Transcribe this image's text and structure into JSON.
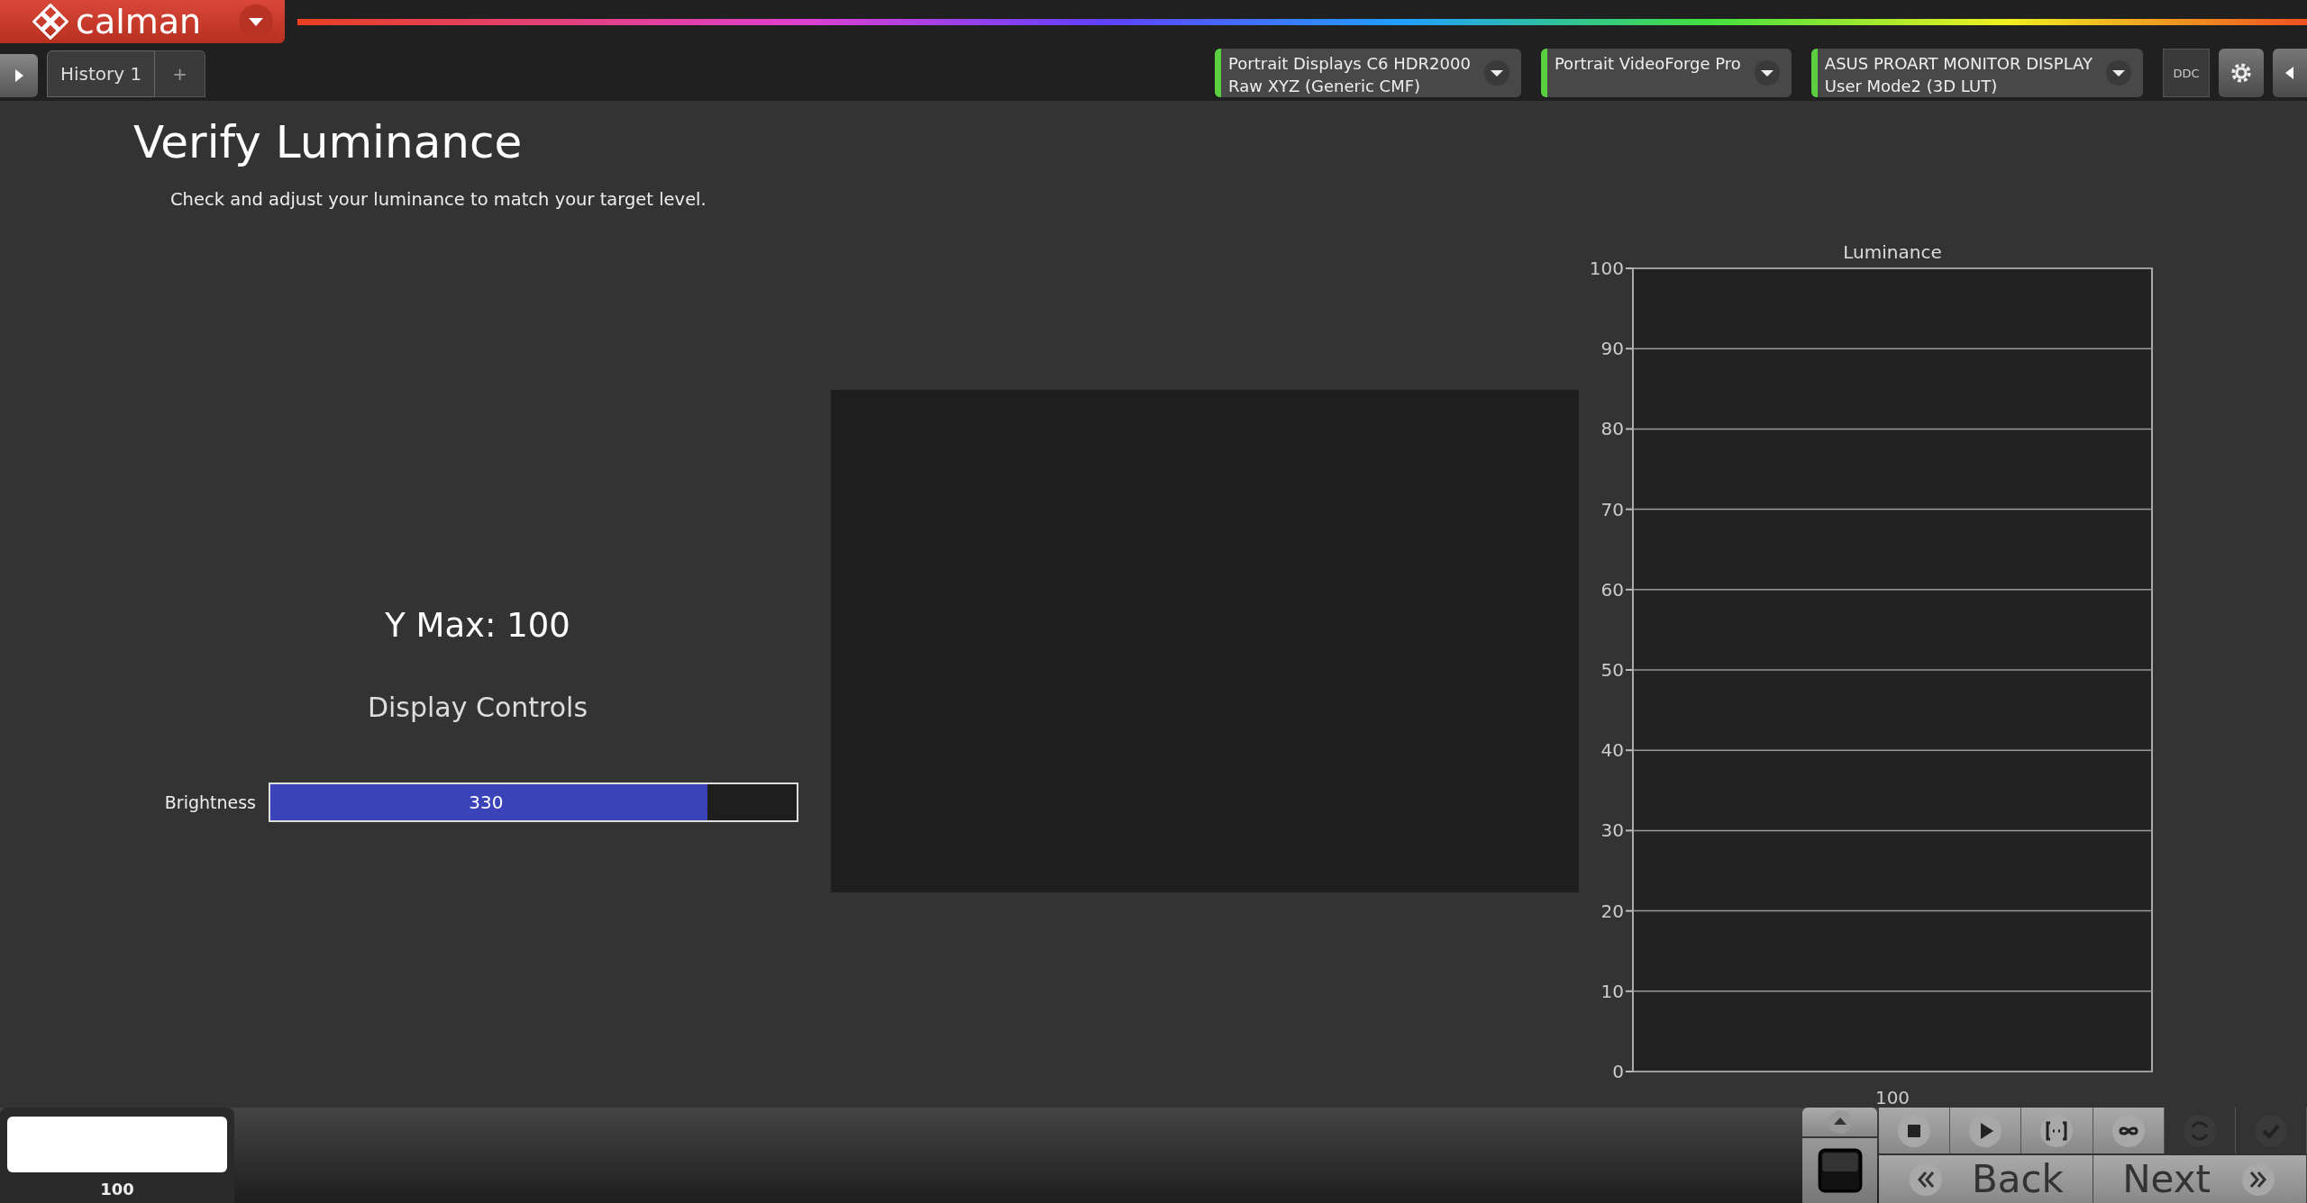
{
  "app_menu": {
    "logo": "calman"
  },
  "tabs": [
    {
      "label": "History 1",
      "selected": true
    }
  ],
  "add_tab": "+",
  "sources": [
    {
      "line1": "Portrait Displays C6 HDR2000",
      "line2": "Raw XYZ (Generic CMF)",
      "connected": true
    },
    {
      "line1": "Portrait VideoForge Pro",
      "connected": true
    },
    {
      "line1": "ASUS PROART MONITOR DISPLAY",
      "line2": "User Mode2 (3D LUT)",
      "connected": true
    }
  ],
  "ddc_button": "DDC",
  "page": {
    "title": "Verify Luminance",
    "subtitle": "Check and adjust your luminance to match your target level."
  },
  "y_max": "Y Max: 100",
  "display_controls": {
    "heading": "Display Controls",
    "controls": [
      {
        "label": "Brightness",
        "value": "330",
        "level": 0.83
      }
    ]
  },
  "chart": {
    "chart_data": {
      "type": "bar",
      "title": "Luminance",
      "categories": [
        "100"
      ],
      "values": [
        null
      ],
      "grid": true,
      "ylim": [
        0,
        100
      ],
      "yticks": [
        0,
        10,
        20,
        30,
        40,
        50,
        60,
        70,
        80,
        90,
        100
      ]
    }
  },
  "swatch": {
    "label": "100"
  },
  "toolbar": [
    {
      "kind": "stop",
      "disabled": false
    },
    {
      "kind": "play",
      "disabled": false
    },
    {
      "kind": "range",
      "disabled": false
    },
    {
      "kind": "loop",
      "disabled": false
    },
    {
      "kind": "refresh",
      "disabled": true
    },
    {
      "kind": "check",
      "disabled": true
    }
  ],
  "nav": {
    "back": "Back",
    "next": "Next"
  }
}
